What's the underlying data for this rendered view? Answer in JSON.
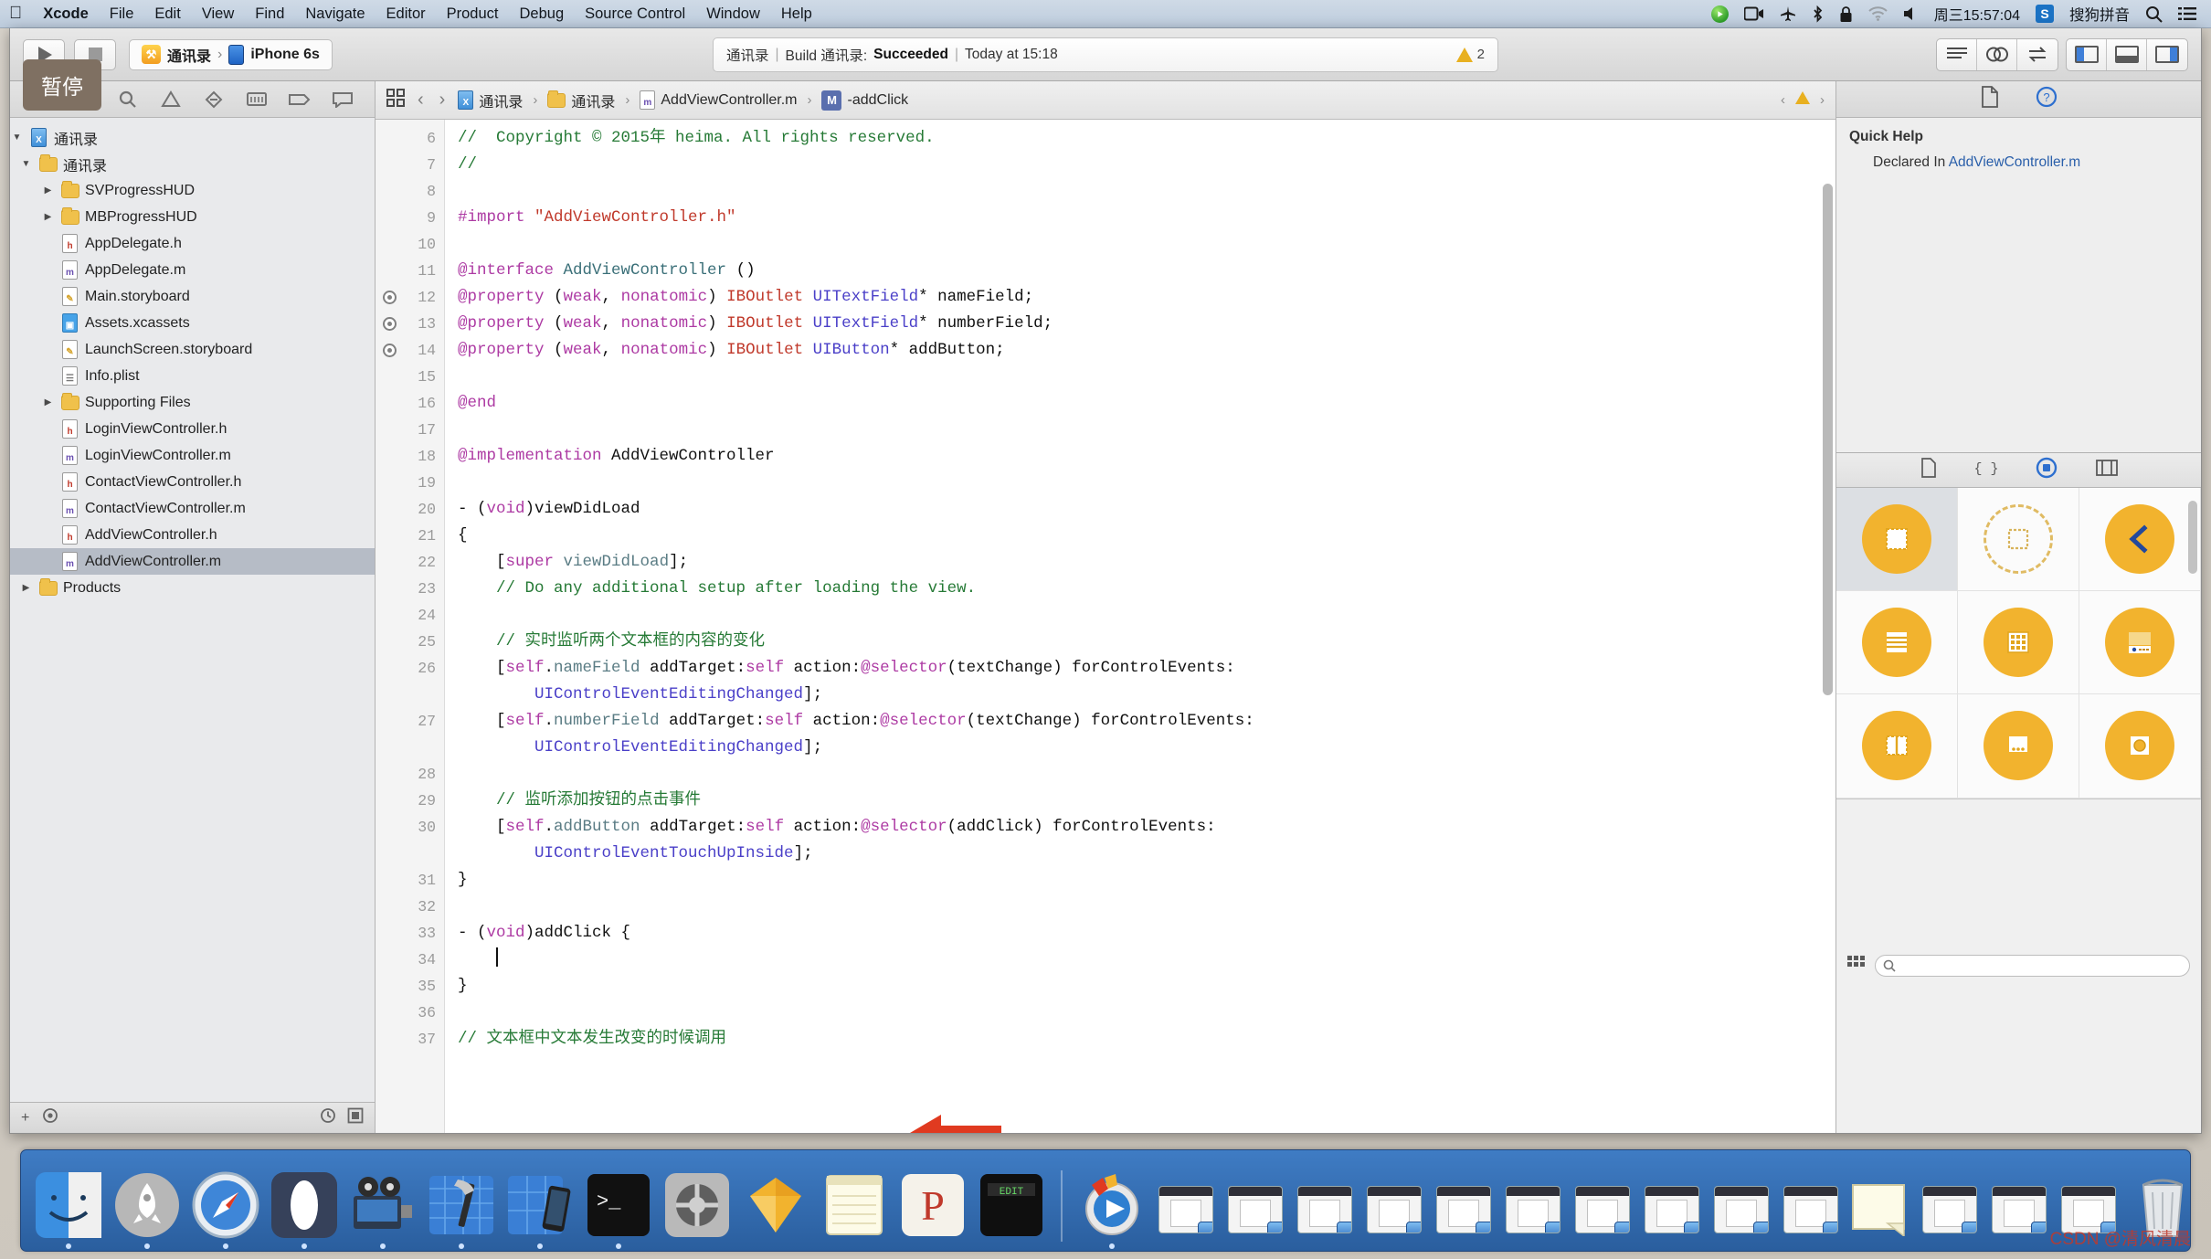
{
  "menubar": {
    "apple_icon": "apple-logo",
    "items": [
      {
        "label": "Xcode",
        "bold": true
      },
      {
        "label": "File",
        "bold": false
      },
      {
        "label": "Edit",
        "bold": false
      },
      {
        "label": "View",
        "bold": false
      },
      {
        "label": "Find",
        "bold": false
      },
      {
        "label": "Navigate",
        "bold": false
      },
      {
        "label": "Editor",
        "bold": false
      },
      {
        "label": "Product",
        "bold": false
      },
      {
        "label": "Debug",
        "bold": false
      },
      {
        "label": "Source Control",
        "bold": false
      },
      {
        "label": "Window",
        "bold": false
      },
      {
        "label": "Help",
        "bold": false
      }
    ],
    "status_icons": [
      "screen-record-icon",
      "camera-icon",
      "airplane-icon",
      "bluetooth-icon",
      "lock-icon",
      "wifi-icon",
      "volume-icon"
    ],
    "clock": "周三15:57:04",
    "input_method_badge": "S",
    "input_method": "搜狗拼音",
    "search_icon": "search-icon",
    "notification_icon": "notification-center-icon"
  },
  "pause_badge": {
    "label": "暂停"
  },
  "toolbar": {
    "run_button": "run-button",
    "stop_button": "stop-button",
    "scheme_name": "通讯录",
    "scheme_separator": "›",
    "destination": "iPhone 6s",
    "status": {
      "project": "通讯录",
      "sep1": "|",
      "build_text": "Build 通讯录:",
      "result": "Succeeded",
      "sep2": "|",
      "time": "Today at 15:18",
      "warning_count": "2"
    },
    "editor_segment": [
      "standard-editor-icon",
      "assistant-editor-icon",
      "version-editor-icon"
    ],
    "view_segment": [
      "toggle-navigator-icon",
      "toggle-debug-icon",
      "toggle-utilities-icon"
    ]
  },
  "navigator": {
    "tabs": [
      "project-navigator-icon",
      "source-control-navigator-icon",
      "find-navigator-icon",
      "issue-navigator-icon",
      "test-navigator-icon",
      "debug-navigator-icon",
      "breakpoint-navigator-icon",
      "report-navigator-icon"
    ],
    "active_tab_index": 0,
    "tree": [
      {
        "label": "通讯录",
        "icon": "project-icon",
        "indent": 0,
        "twisty": "down",
        "selected": false
      },
      {
        "label": "通讯录",
        "icon": "folder",
        "indent": 1,
        "twisty": "down",
        "selected": false
      },
      {
        "label": "SVProgressHUD",
        "icon": "folder",
        "indent": 2,
        "twisty": "right",
        "selected": false
      },
      {
        "label": "MBProgressHUD",
        "icon": "folder",
        "indent": 2,
        "twisty": "right",
        "selected": false
      },
      {
        "label": "AppDelegate.h",
        "icon": "header-file",
        "indent": 2,
        "twisty": "none",
        "selected": false
      },
      {
        "label": "AppDelegate.m",
        "icon": "impl-file",
        "indent": 2,
        "twisty": "none",
        "selected": false
      },
      {
        "label": "Main.storyboard",
        "icon": "storyboard-file",
        "indent": 2,
        "twisty": "none",
        "selected": false
      },
      {
        "label": "Assets.xcassets",
        "icon": "assets-file",
        "indent": 2,
        "twisty": "none",
        "selected": false
      },
      {
        "label": "LaunchScreen.storyboard",
        "icon": "storyboard-file",
        "indent": 2,
        "twisty": "none",
        "selected": false
      },
      {
        "label": "Info.plist",
        "icon": "plist-file",
        "indent": 2,
        "twisty": "none",
        "selected": false
      },
      {
        "label": "Supporting Files",
        "icon": "folder",
        "indent": 2,
        "twisty": "right",
        "selected": false
      },
      {
        "label": "LoginViewController.h",
        "icon": "header-file",
        "indent": 2,
        "twisty": "none",
        "selected": false
      },
      {
        "label": "LoginViewController.m",
        "icon": "impl-file",
        "indent": 2,
        "twisty": "none",
        "selected": false
      },
      {
        "label": "ContactViewController.h",
        "icon": "header-file",
        "indent": 2,
        "twisty": "none",
        "selected": false
      },
      {
        "label": "ContactViewController.m",
        "icon": "impl-file",
        "indent": 2,
        "twisty": "none",
        "selected": false
      },
      {
        "label": "AddViewController.h",
        "icon": "header-file",
        "indent": 2,
        "twisty": "none",
        "selected": false
      },
      {
        "label": "AddViewController.m",
        "icon": "impl-file",
        "indent": 2,
        "twisty": "none",
        "selected": true
      },
      {
        "label": "Products",
        "icon": "folder",
        "indent": 1,
        "twisty": "right",
        "selected": false
      }
    ],
    "footer": {
      "add_button": "+",
      "filter_icon": "filter-icon",
      "recent_icon": "recent-files-icon",
      "source_control_icon": "source-control-filter-icon"
    }
  },
  "jumpbar": {
    "related_items_icon": "related-items-icon",
    "back_arrow": "‹",
    "forward_arrow": "›",
    "crumbs": [
      {
        "label": "通讯录",
        "icon": "project-icon"
      },
      {
        "label": "通讯录",
        "icon": "folder"
      },
      {
        "label": "AddViewController.m",
        "icon": "impl-file"
      },
      {
        "label": "-addClick",
        "icon": "method-icon"
      }
    ],
    "right_icons": [
      "previous-issue-icon",
      "warning-icon",
      "next-issue-icon"
    ]
  },
  "editor": {
    "first_line_number": 6,
    "lines": [
      {
        "n": 6,
        "marker": false,
        "tokens": [
          {
            "t": "//  Copyright © 2015年 heima. All rights reserved.",
            "c": "c-cmt"
          }
        ]
      },
      {
        "n": 7,
        "marker": false,
        "tokens": [
          {
            "t": "//",
            "c": "c-cmt"
          }
        ]
      },
      {
        "n": 8,
        "marker": false,
        "tokens": []
      },
      {
        "n": 9,
        "marker": false,
        "tokens": [
          {
            "t": "#import ",
            "c": "c-pre"
          },
          {
            "t": "\"AddViewController.h\"",
            "c": "c-str"
          }
        ]
      },
      {
        "n": 10,
        "marker": false,
        "tokens": []
      },
      {
        "n": 11,
        "marker": false,
        "tokens": [
          {
            "t": "@interface ",
            "c": "c-kw"
          },
          {
            "t": "AddViewController",
            "c": "c-cls"
          },
          {
            "t": " ()",
            "c": "c-plain"
          }
        ]
      },
      {
        "n": 12,
        "marker": true,
        "tokens": [
          {
            "t": "@property",
            "c": "c-kw"
          },
          {
            "t": " (",
            "c": "c-plain"
          },
          {
            "t": "weak",
            "c": "c-kw"
          },
          {
            "t": ", ",
            "c": "c-plain"
          },
          {
            "t": "nonatomic",
            "c": "c-kw"
          },
          {
            "t": ") ",
            "c": "c-plain"
          },
          {
            "t": "IBOutlet ",
            "c": "c-str"
          },
          {
            "t": "UITextField",
            "c": "c-type"
          },
          {
            "t": "* nameField;",
            "c": "c-plain"
          }
        ]
      },
      {
        "n": 13,
        "marker": true,
        "tokens": [
          {
            "t": "@property",
            "c": "c-kw"
          },
          {
            "t": " (",
            "c": "c-plain"
          },
          {
            "t": "weak",
            "c": "c-kw"
          },
          {
            "t": ", ",
            "c": "c-plain"
          },
          {
            "t": "nonatomic",
            "c": "c-kw"
          },
          {
            "t": ") ",
            "c": "c-plain"
          },
          {
            "t": "IBOutlet ",
            "c": "c-str"
          },
          {
            "t": "UITextField",
            "c": "c-type"
          },
          {
            "t": "* numberField;",
            "c": "c-plain"
          }
        ]
      },
      {
        "n": 14,
        "marker": true,
        "tokens": [
          {
            "t": "@property",
            "c": "c-kw"
          },
          {
            "t": " (",
            "c": "c-plain"
          },
          {
            "t": "weak",
            "c": "c-kw"
          },
          {
            "t": ", ",
            "c": "c-plain"
          },
          {
            "t": "nonatomic",
            "c": "c-kw"
          },
          {
            "t": ") ",
            "c": "c-plain"
          },
          {
            "t": "IBOutlet ",
            "c": "c-str"
          },
          {
            "t": "UIButton",
            "c": "c-type"
          },
          {
            "t": "* addButton;",
            "c": "c-plain"
          }
        ]
      },
      {
        "n": 15,
        "marker": false,
        "tokens": []
      },
      {
        "n": 16,
        "marker": false,
        "tokens": [
          {
            "t": "@end",
            "c": "c-kw"
          }
        ]
      },
      {
        "n": 17,
        "marker": false,
        "tokens": []
      },
      {
        "n": 18,
        "marker": false,
        "tokens": [
          {
            "t": "@implementation ",
            "c": "c-kw"
          },
          {
            "t": "AddViewController",
            "c": "c-plain"
          }
        ]
      },
      {
        "n": 19,
        "marker": false,
        "tokens": []
      },
      {
        "n": 20,
        "marker": false,
        "tokens": [
          {
            "t": "- (",
            "c": "c-plain"
          },
          {
            "t": "void",
            "c": "c-kw"
          },
          {
            "t": ")viewDidLoad",
            "c": "c-plain"
          }
        ]
      },
      {
        "n": 21,
        "marker": false,
        "tokens": [
          {
            "t": "{",
            "c": "c-plain"
          }
        ]
      },
      {
        "n": 22,
        "marker": false,
        "tokens": [
          {
            "t": "    [",
            "c": "c-plain"
          },
          {
            "t": "super",
            "c": "c-kw"
          },
          {
            "t": " ",
            "c": "c-plain"
          },
          {
            "t": "viewDidLoad",
            "c": "c-prop"
          },
          {
            "t": "];",
            "c": "c-plain"
          }
        ]
      },
      {
        "n": 23,
        "marker": false,
        "tokens": [
          {
            "t": "    // Do any additional setup after loading the view.",
            "c": "c-cmt"
          }
        ]
      },
      {
        "n": 24,
        "marker": false,
        "tokens": []
      },
      {
        "n": 25,
        "marker": false,
        "tokens": [
          {
            "t": "    // 实时监听两个文本框的内容的变化",
            "c": "c-cmt"
          }
        ]
      },
      {
        "n": 26,
        "marker": false,
        "tokens": [
          {
            "t": "    [",
            "c": "c-plain"
          },
          {
            "t": "self",
            "c": "c-kw"
          },
          {
            "t": ".",
            "c": "c-plain"
          },
          {
            "t": "nameField",
            "c": "c-prop"
          },
          {
            "t": " addTarget:",
            "c": "c-plain"
          },
          {
            "t": "self",
            "c": "c-kw"
          },
          {
            "t": " action:",
            "c": "c-plain"
          },
          {
            "t": "@selector",
            "c": "c-kw"
          },
          {
            "t": "(textChange) forControlEvents:",
            "c": "c-plain"
          }
        ]
      },
      {
        "n": 26,
        "cont": true,
        "marker": false,
        "tokens": [
          {
            "t": "        ",
            "c": "c-plain"
          },
          {
            "t": "UIControlEventEditingChanged",
            "c": "c-type"
          },
          {
            "t": "];",
            "c": "c-plain"
          }
        ]
      },
      {
        "n": 27,
        "marker": false,
        "tokens": [
          {
            "t": "    [",
            "c": "c-plain"
          },
          {
            "t": "self",
            "c": "c-kw"
          },
          {
            "t": ".",
            "c": "c-plain"
          },
          {
            "t": "numberField",
            "c": "c-prop"
          },
          {
            "t": " addTarget:",
            "c": "c-plain"
          },
          {
            "t": "self",
            "c": "c-kw"
          },
          {
            "t": " action:",
            "c": "c-plain"
          },
          {
            "t": "@selector",
            "c": "c-kw"
          },
          {
            "t": "(textChange) forControlEvents:",
            "c": "c-plain"
          }
        ]
      },
      {
        "n": 27,
        "cont": true,
        "marker": false,
        "tokens": [
          {
            "t": "        ",
            "c": "c-plain"
          },
          {
            "t": "UIControlEventEditingChanged",
            "c": "c-type"
          },
          {
            "t": "];",
            "c": "c-plain"
          }
        ]
      },
      {
        "n": 28,
        "marker": false,
        "tokens": []
      },
      {
        "n": 29,
        "marker": false,
        "tokens": [
          {
            "t": "    // 监听添加按钮的点击事件",
            "c": "c-cmt"
          }
        ]
      },
      {
        "n": 30,
        "marker": false,
        "tokens": [
          {
            "t": "    [",
            "c": "c-plain"
          },
          {
            "t": "self",
            "c": "c-kw"
          },
          {
            "t": ".",
            "c": "c-plain"
          },
          {
            "t": "addButton",
            "c": "c-prop"
          },
          {
            "t": " addTarget:",
            "c": "c-plain"
          },
          {
            "t": "self",
            "c": "c-kw"
          },
          {
            "t": " action:",
            "c": "c-plain"
          },
          {
            "t": "@selector",
            "c": "c-kw"
          },
          {
            "t": "(addClick) forControlEvents:",
            "c": "c-plain"
          }
        ]
      },
      {
        "n": 30,
        "cont": true,
        "marker": false,
        "tokens": [
          {
            "t": "        ",
            "c": "c-plain"
          },
          {
            "t": "UIControlEventTouchUpInside",
            "c": "c-type"
          },
          {
            "t": "];",
            "c": "c-plain"
          }
        ]
      },
      {
        "n": 31,
        "marker": false,
        "tokens": [
          {
            "t": "}",
            "c": "c-plain"
          }
        ]
      },
      {
        "n": 32,
        "marker": false,
        "tokens": []
      },
      {
        "n": 33,
        "marker": false,
        "tokens": [
          {
            "t": "- (",
            "c": "c-plain"
          },
          {
            "t": "void",
            "c": "c-kw"
          },
          {
            "t": ")addClick {",
            "c": "c-plain"
          }
        ]
      },
      {
        "n": 34,
        "marker": false,
        "cursor": true,
        "tokens": [
          {
            "t": "    ",
            "c": "c-plain"
          }
        ]
      },
      {
        "n": 35,
        "marker": false,
        "tokens": [
          {
            "t": "}",
            "c": "c-plain"
          }
        ]
      },
      {
        "n": 36,
        "marker": false,
        "tokens": []
      },
      {
        "n": 37,
        "marker": false,
        "tokens": [
          {
            "t": "// 文本框中文本发生改变的时候调用",
            "c": "c-cmt"
          }
        ]
      }
    ],
    "annotation_arrow": "red-pointer-arrow"
  },
  "utilities": {
    "tabs": [
      "file-inspector-icon",
      "quick-help-inspector-icon"
    ],
    "active_tab_index": 1,
    "quick_help": {
      "title": "Quick Help",
      "declared_label": "Declared In",
      "declared_value": "AddViewController.m"
    },
    "library_tabs": [
      "file-template-library-icon",
      "code-snippet-library-icon",
      "object-library-icon",
      "media-library-icon"
    ],
    "library_active_index": 2,
    "library_objects": [
      {
        "name": "view-controller-object",
        "selected": true
      },
      {
        "name": "storyboard-reference-object",
        "selected": false
      },
      {
        "name": "navigation-controller-object",
        "selected": false
      },
      {
        "name": "table-view-controller-object",
        "selected": false
      },
      {
        "name": "collection-view-controller-object",
        "selected": false
      },
      {
        "name": "tab-bar-controller-object",
        "selected": false
      },
      {
        "name": "split-view-controller-object",
        "selected": false
      },
      {
        "name": "page-view-controller-object",
        "selected": false
      },
      {
        "name": "glkit-view-controller-object",
        "selected": false
      }
    ],
    "library_footer": {
      "layout_icon": "grid-layout-icon",
      "search_placeholder": "",
      "search_icon": "search-icon"
    }
  },
  "dock": {
    "apps": [
      {
        "name": "finder-icon"
      },
      {
        "name": "launchpad-icon"
      },
      {
        "name": "safari-icon"
      },
      {
        "name": "mail-icon"
      },
      {
        "name": "quicktime-icon"
      },
      {
        "name": "xcode-icon"
      },
      {
        "name": "xcode-simulator-icon"
      },
      {
        "name": "terminal-icon"
      },
      {
        "name": "system-preferences-icon"
      },
      {
        "name": "sketch-icon"
      },
      {
        "name": "notes-icon"
      },
      {
        "name": "keynote-icon"
      },
      {
        "name": "editor-icon"
      },
      {
        "name": "quicktime-player-icon"
      }
    ],
    "windows": [
      {
        "name": "minimized-window-1"
      },
      {
        "name": "minimized-window-2"
      },
      {
        "name": "minimized-window-3"
      },
      {
        "name": "minimized-window-4"
      },
      {
        "name": "minimized-window-5"
      },
      {
        "name": "minimized-window-6"
      },
      {
        "name": "minimized-window-7"
      },
      {
        "name": "minimized-window-8"
      },
      {
        "name": "minimized-window-9"
      },
      {
        "name": "minimized-window-10"
      },
      {
        "name": "minimized-note-window"
      },
      {
        "name": "minimized-window-11"
      },
      {
        "name": "minimized-window-12"
      },
      {
        "name": "minimized-window-13"
      }
    ],
    "trash": "trash-icon"
  },
  "watermark": {
    "text": "CSDN @清风清晨"
  },
  "colors": {
    "accent_blue": "#3f7fd8",
    "xcode_yellow": "#f2b32e",
    "comment_green": "#267a36",
    "keyword_purple": "#ad3aa3",
    "string_red": "#c0392b",
    "arrow_red": "#e03a20",
    "dock_blue": "#3f7cc4"
  }
}
